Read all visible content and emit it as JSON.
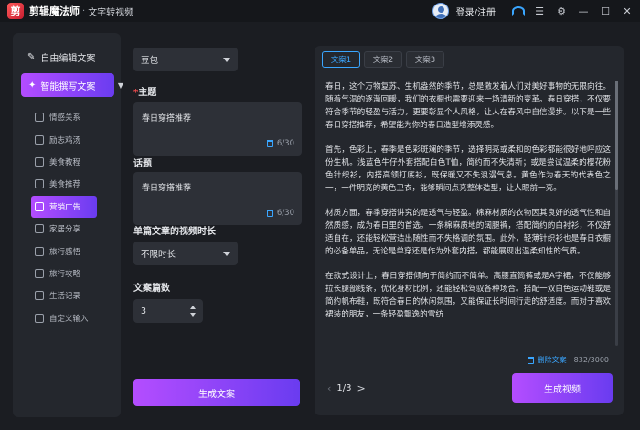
{
  "titlebar": {
    "app_name": "剪辑魔法师",
    "separator": "·",
    "module": "文字转视频",
    "login": "登录/注册",
    "icons": [
      "avatar",
      "headset-icon",
      "menu-icon",
      "settings-icon",
      "minimize-icon",
      "maximize-icon",
      "close-icon"
    ]
  },
  "sidebar": {
    "free_edit": "自由编辑文案",
    "smart_write": "智能撰写文案",
    "items": [
      {
        "label": "情感关系"
      },
      {
        "label": "励志鸡汤"
      },
      {
        "label": "美食教程"
      },
      {
        "label": "美食推荐"
      },
      {
        "label": "营销广告",
        "active": true
      },
      {
        "label": "家居分享"
      },
      {
        "label": "旅行感悟"
      },
      {
        "label": "旅行攻略"
      },
      {
        "label": "生活记录"
      },
      {
        "label": "自定义输入"
      }
    ]
  },
  "form": {
    "model_select": "豆包",
    "topic_label": "主题",
    "topic_value": "春日穿搭推荐",
    "topic_count": "6/30",
    "title_label": "话题",
    "title_value": "春日穿搭推荐",
    "title_count": "6/30",
    "duration_label": "单篇文章的视频时长",
    "duration_value": "不限时长",
    "count_label": "文案篇数",
    "count_value": "3",
    "generate_label": "生成文案"
  },
  "result": {
    "tabs": [
      "文案1",
      "文案2",
      "文案3"
    ],
    "paragraphs": [
      "春日，这个万物复苏、生机盎然的季节，总是激发着人们对美好事物的无限向往。随着气温的逐渐回暖，我们的衣橱也需要迎来一场清新的变革。春日穿搭，不仅要符合季节的轻盈与活力，更要彰显个人风格，让人在春风中自信漫步。以下是一些春日穿搭推荐，希望能为你的春日造型增添灵感。",
      "首先，色彩上，春季是色彩斑斓的季节，选择明亮或柔和的色彩都能很好地呼应这份生机。浅蓝色牛仔外套搭配白色T恤，简约而不失清新；或是尝试温柔的樱花粉色针织衫，内搭高领打底衫，既保暖又不失浪漫气息。黄色作为春天的代表色之一，一件明亮的黄色卫衣，能够瞬间点亮整体造型，让人眼前一亮。",
      "材质方面，春季穿搭讲究的是透气与轻盈。棉麻材质的衣物因其良好的透气性和自然质感，成为春日里的首选。一条棉麻质地的阔腿裤，搭配简约的白衬衫，不仅舒适自在，还能轻松营造出随性而不失格调的氛围。此外，轻薄针织衫也是春日衣橱的必备单品，无论是单穿还是作为外套内搭，都能展现出温柔知性的气质。",
      "在款式设计上，春日穿搭倾向于简约而不简单。高腰直筒裤或是A字裙，不仅能够拉长腿部线条，优化身材比例，还能轻松驾驭各种场合。搭配一双白色运动鞋或是简约帆布鞋，既符合春日的休闲氛围，又能保证长时间行走的舒适度。而对于喜欢裙装的朋友，一条轻盈飘逸的雪纺"
    ],
    "delete_label": "删除文案",
    "char_count": "832/3000",
    "page": "1/3",
    "prev": "‹",
    "next": ">",
    "video_label": "生成视频"
  }
}
